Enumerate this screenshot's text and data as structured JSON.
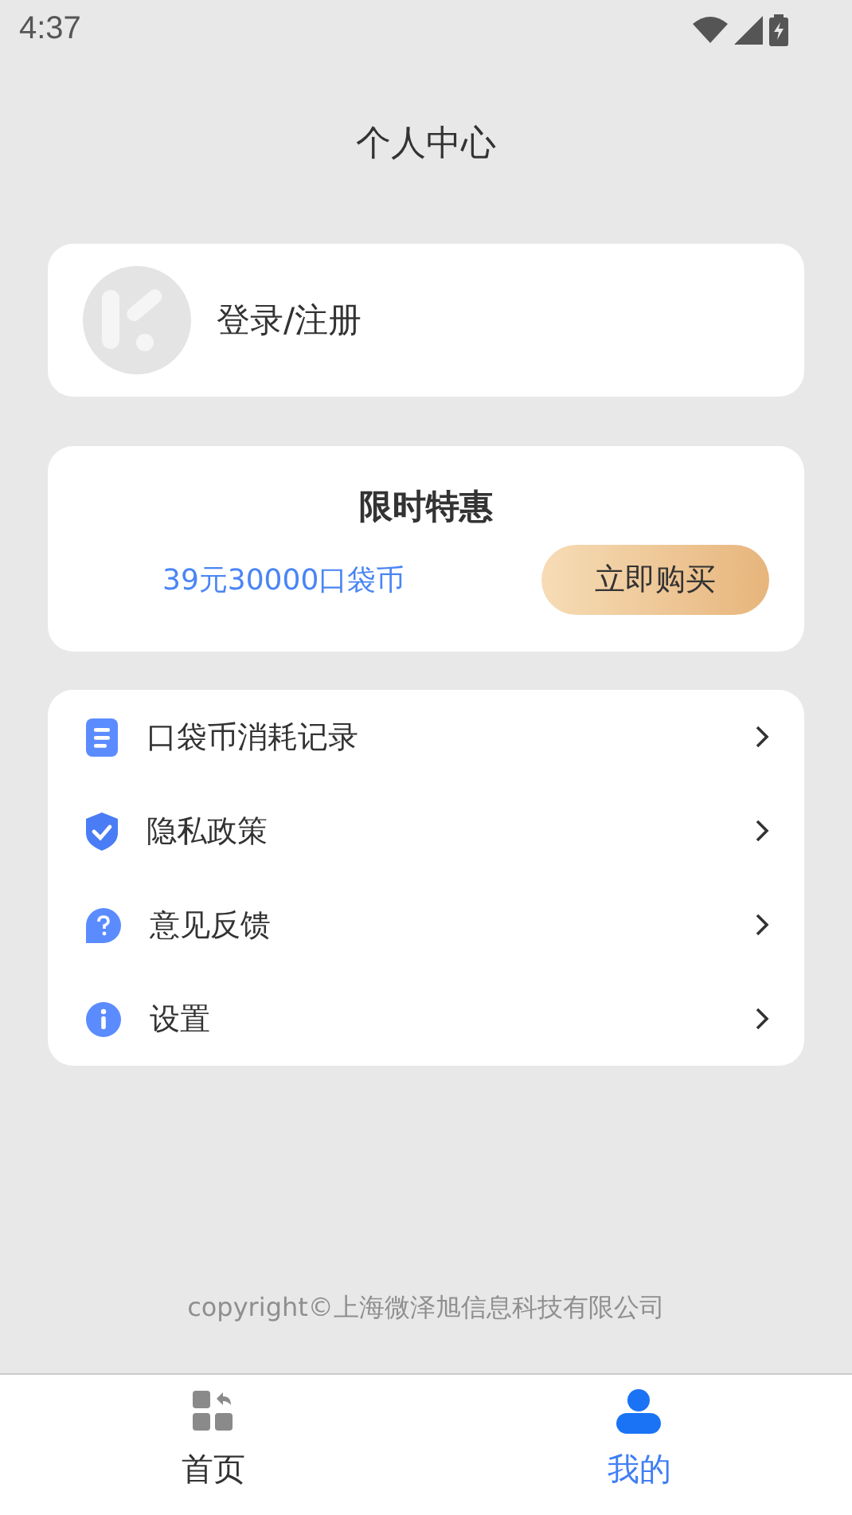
{
  "status_bar": {
    "time": "4:37"
  },
  "header": {
    "title": "个人中心"
  },
  "account": {
    "label": "登录/注册"
  },
  "promo": {
    "title": "限时特惠",
    "offer": "39元30000口袋币",
    "button": "立即购买"
  },
  "menu": [
    {
      "kind": "document",
      "label": "口袋币消耗记录"
    },
    {
      "kind": "shield",
      "label": "隐私政策"
    },
    {
      "kind": "question",
      "label": "意见反馈"
    },
    {
      "kind": "info",
      "label": "设置"
    }
  ],
  "footer": {
    "copyright": "copyright©上海微泽旭信息科技有限公司"
  },
  "tabs": [
    {
      "kind": "home",
      "label": "首页",
      "selected": false
    },
    {
      "kind": "profile",
      "label": "我的",
      "selected": true
    }
  ]
}
